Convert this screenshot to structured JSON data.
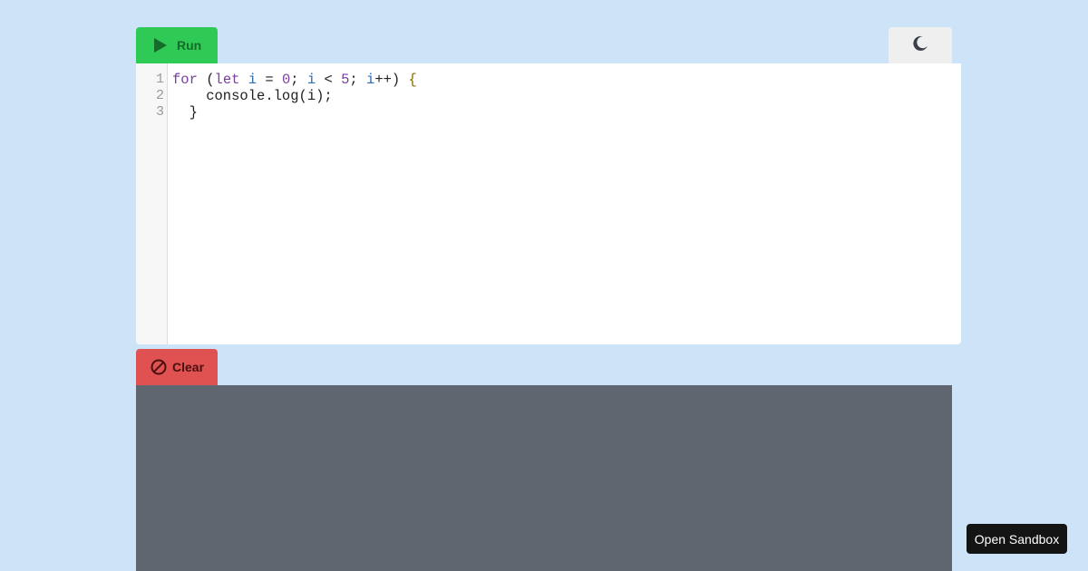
{
  "toolbar": {
    "run_label": "Run",
    "run_icon": "play-icon",
    "theme_icon": "moon-icon"
  },
  "editor": {
    "line_numbers": [
      "1",
      "2",
      "3"
    ],
    "lines": [
      "for (let i = 0; i < 5; i++) {",
      "    console.log(i);",
      "  }"
    ],
    "line1": {
      "t1": "for",
      "t2": " (",
      "t3": "let",
      "t4": " ",
      "t5": "i",
      "t6": " = ",
      "t7": "0",
      "t8": "; ",
      "t9": "i",
      "t10": " < ",
      "t11": "5",
      "t12": "; ",
      "t13": "i",
      "t14": "++) ",
      "t15": "{"
    },
    "line2": "    console.log(i);",
    "line3": "  }"
  },
  "console": {
    "clear_label": "Clear",
    "clear_icon": "ban-icon"
  },
  "sandbox": {
    "label": "Open Sandbox"
  },
  "colors": {
    "background": "#cde3f8",
    "run": "#2fca55",
    "clear": "#e05252",
    "console": "#5f6670",
    "keyword": "#7a3e9d",
    "variable": "#2f6db5"
  }
}
